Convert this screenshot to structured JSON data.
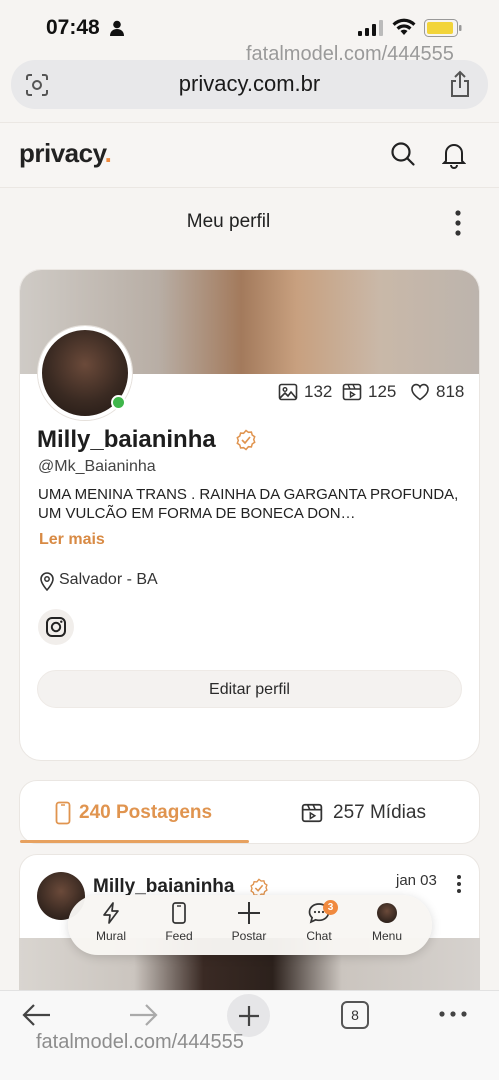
{
  "status_bar": {
    "time": "07:48"
  },
  "watermark": {
    "top": "fatalmodel.com/444555",
    "bottom": "fatalmodel.com/444555"
  },
  "browser": {
    "url": "privacy.com.br",
    "open_tabs": "8"
  },
  "app": {
    "logo_text": "privacy",
    "logo_dot": ".",
    "accent_color": "#f08a3e"
  },
  "page": {
    "title": "Meu perfil"
  },
  "profile": {
    "display_name": "Milly_baianinha",
    "handle": "@Mk_Baianinha",
    "bio": "UMA MENINA TRANS . RAINHA DA GARGANTA PROFUNDA, UM VULCÃO EM FORMA DE BONECA DON…",
    "read_more": "Ler mais",
    "location": "Salvador - BA",
    "stats": {
      "photos": "132",
      "videos": "125",
      "likes": "818"
    },
    "edit_button": "Editar perfil",
    "online_color": "#3fb64b"
  },
  "tabs": {
    "posts": "240 Postagens",
    "media": "257 Mídias"
  },
  "post": {
    "author": "Milly_baianinha",
    "date": "jan 03"
  },
  "bottom_nav": {
    "items": [
      {
        "label": "Mural",
        "icon": "lightning-icon"
      },
      {
        "label": "Feed",
        "icon": "phone-icon"
      },
      {
        "label": "Postar",
        "icon": "plus-icon"
      },
      {
        "label": "Chat",
        "icon": "chat-icon"
      },
      {
        "label": "Menu",
        "icon": "avatar-icon"
      }
    ],
    "chat_badge": "3"
  }
}
